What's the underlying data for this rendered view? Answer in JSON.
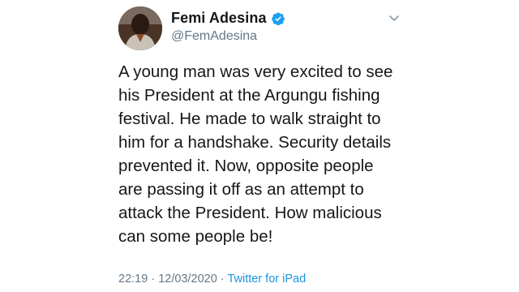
{
  "author": {
    "display_name": "Femi Adesina",
    "handle": "@FemAdesina",
    "verified": true,
    "avatar_icon": "profile-photo"
  },
  "tweet": {
    "text": "A young man was very excited to see\nhis President at the Argungu fishing\nfestival. He made to walk straight to\nhim for a handshake. Security details\nprevented it. Now, opposite people\nare passing it off as an attempt to\nattack the President. How malicious\ncan some people be!"
  },
  "meta": {
    "time": "22:19",
    "separator": "·",
    "date": "12/03/2020",
    "source": "Twitter for iPad"
  },
  "colors": {
    "text": "#14171a",
    "secondary": "#657786",
    "link": "#1b95e0",
    "verified": "#1da1f2"
  },
  "icons": {
    "verified": "verified-badge-icon",
    "menu": "chevron-down-icon"
  }
}
